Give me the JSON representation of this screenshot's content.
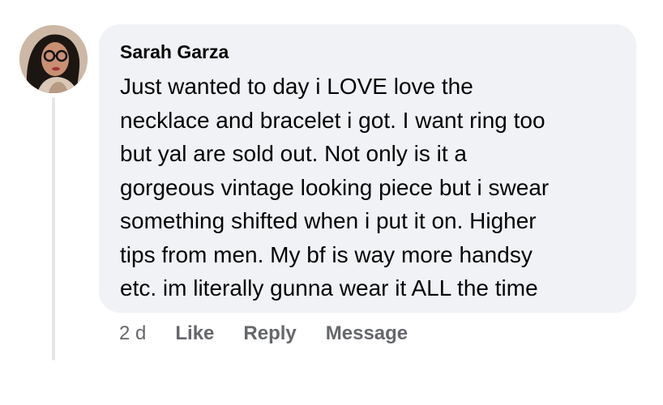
{
  "comment": {
    "author": "Sarah Garza",
    "text_lines": [
      "Just wanted to day i LOVE love the",
      "necklace and bracelet i got. I want ring too",
      "but yal are sold out. Not only is it a",
      "gorgeous vintage looking piece but i swear",
      "something shifted when i put it on. Higher",
      "tips from men. My bf is way more handsy",
      "etc. im literally gunna wear it ALL the time"
    ],
    "timestamp": "2 d",
    "like_label": "Like",
    "reply_label": "Reply",
    "message_label": "Message"
  },
  "colors": {
    "bubble_bg": "#f0f2f5",
    "text": "#050505",
    "meta_text": "#65676b",
    "thread_line": "#e4e6eb"
  },
  "icons": {
    "avatar": "user-avatar"
  }
}
